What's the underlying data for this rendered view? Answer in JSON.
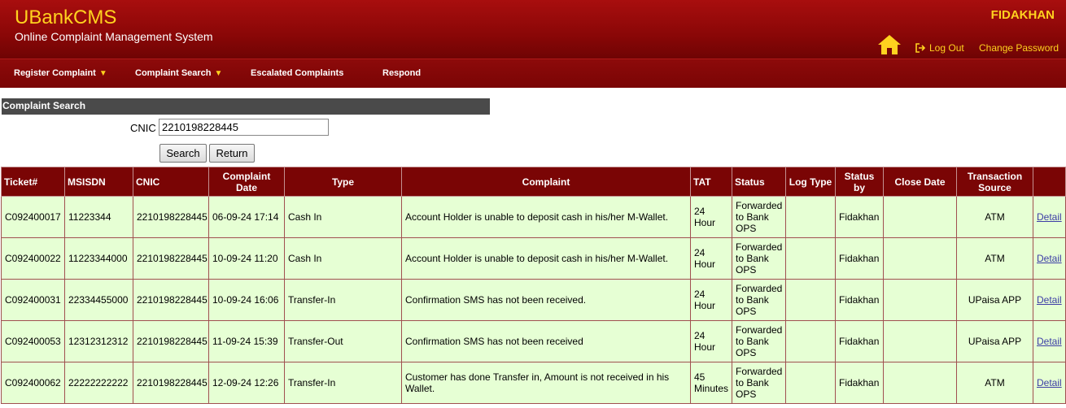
{
  "header": {
    "brand": "UBankCMS",
    "subtitle": "Online Complaint Management System",
    "username": "FIDAKHAN",
    "logout_label": "Log Out",
    "change_password_label": "Change Password",
    "colors": {
      "primary": "#8a0707",
      "accent": "#ffd21f"
    }
  },
  "nav": {
    "items": [
      {
        "label": "Register Complaint",
        "has_dropdown": true
      },
      {
        "label": "Complaint Search",
        "has_dropdown": true
      },
      {
        "label": "Escalated Complaints",
        "has_dropdown": false
      },
      {
        "label": "Respond",
        "has_dropdown": false
      }
    ]
  },
  "search": {
    "section_title": "Complaint Search",
    "cnic_label": "CNIC",
    "cnic_value": "2210198228445",
    "search_button": "Search",
    "return_button": "Return"
  },
  "table": {
    "columns": [
      "Ticket#",
      "MSISDN",
      "CNIC",
      "Complaint Date",
      "Type",
      "Complaint",
      "TAT",
      "Status",
      "Log Type",
      "Status by",
      "Close Date",
      "Transaction Source",
      ""
    ],
    "rows": [
      {
        "ticket": "C092400017",
        "msisdn": "11223344",
        "cnic": "2210198228445",
        "date": "06-09-24 17:14",
        "type": "Cash In",
        "complaint": "Account Holder is unable to deposit cash in his/her M-Wallet.",
        "tat": "24 Hour",
        "status": "Forwarded to Bank OPS",
        "log_type": "",
        "status_by": "Fidakhan",
        "close_date": "",
        "source": "ATM",
        "action": "Detail"
      },
      {
        "ticket": "C092400022",
        "msisdn": "11223344000",
        "cnic": "2210198228445",
        "date": "10-09-24 11:20",
        "type": "Cash In",
        "complaint": "Account Holder is unable to deposit cash in his/her M-Wallet.",
        "tat": "24 Hour",
        "status": "Forwarded to Bank OPS",
        "log_type": "",
        "status_by": "Fidakhan",
        "close_date": "",
        "source": "ATM",
        "action": "Detail"
      },
      {
        "ticket": "C092400031",
        "msisdn": "22334455000",
        "cnic": "2210198228445",
        "date": "10-09-24 16:06",
        "type": "Transfer-In",
        "complaint": "Confirmation SMS has not been received.",
        "tat": "24 Hour",
        "status": "Forwarded to Bank OPS",
        "log_type": "",
        "status_by": "Fidakhan",
        "close_date": "",
        "source": "UPaisa APP",
        "action": "Detail"
      },
      {
        "ticket": "C092400053",
        "msisdn": "12312312312",
        "cnic": "2210198228445",
        "date": "11-09-24 15:39",
        "type": "Transfer-Out",
        "complaint": "Confirmation SMS has not been received",
        "tat": "24 Hour",
        "status": "Forwarded to Bank OPS",
        "log_type": "",
        "status_by": "Fidakhan",
        "close_date": "",
        "source": "UPaisa APP",
        "action": "Detail"
      },
      {
        "ticket": "C092400062",
        "msisdn": "22222222222",
        "cnic": "2210198228445",
        "date": "12-09-24 12:26",
        "type": "Transfer-In",
        "complaint": "Customer has done Transfer in, Amount is not received in his Wallet.",
        "tat": "45 Minutes",
        "status": "Forwarded to Bank OPS",
        "log_type": "",
        "status_by": "Fidakhan",
        "close_date": "",
        "source": "ATM",
        "action": "Detail"
      }
    ]
  }
}
